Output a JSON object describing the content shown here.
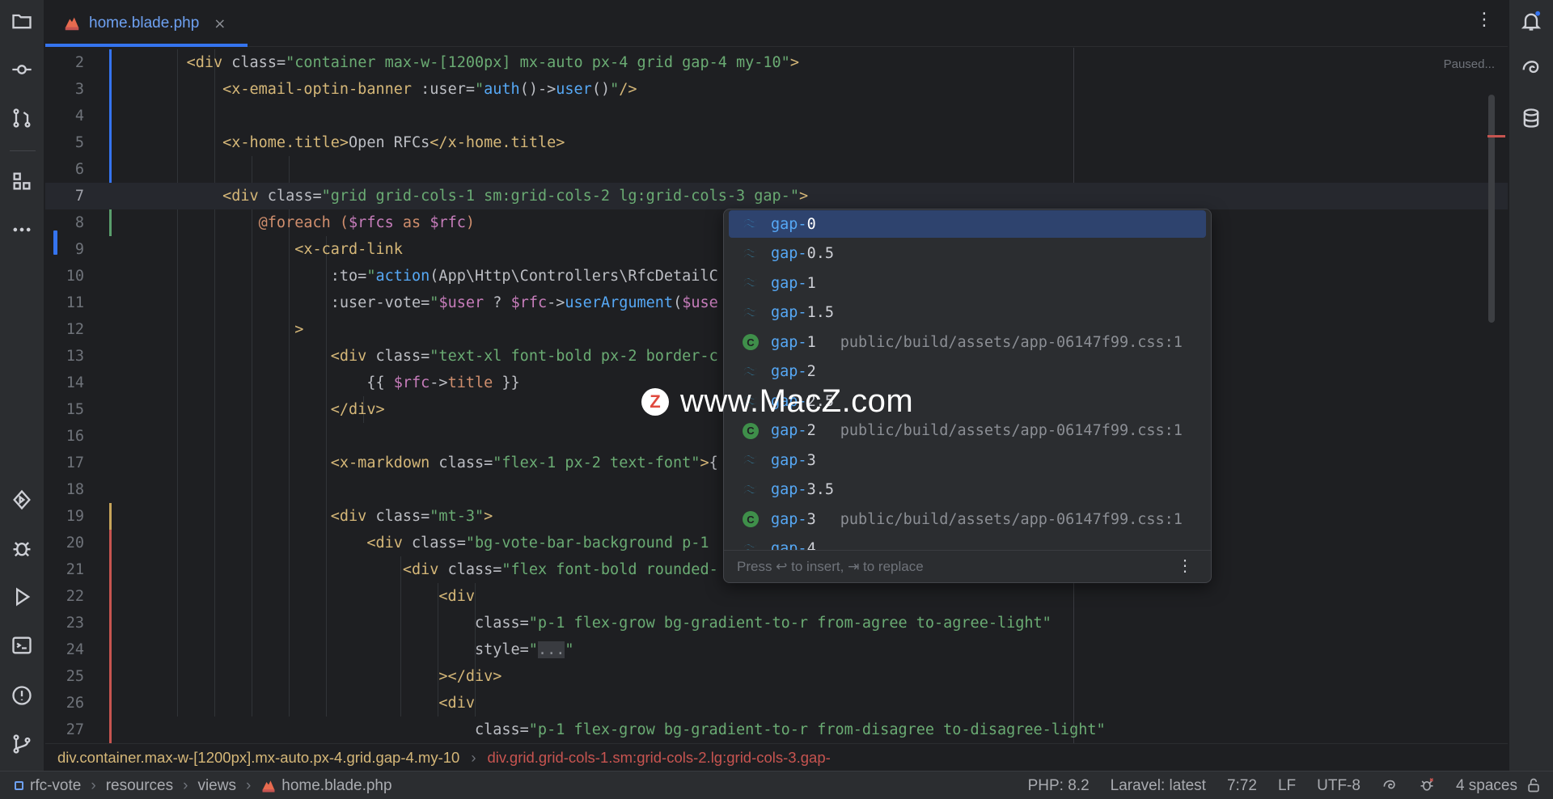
{
  "tab": {
    "label": "home.blade.php",
    "close": "×",
    "more": "⋮"
  },
  "editor": {
    "status": "Paused..."
  },
  "lines": [
    {
      "n": "2",
      "tokens": [
        [
          "t-plain",
          "    "
        ],
        [
          "t-tag",
          "<div"
        ],
        [
          "t-attr",
          " class="
        ],
        [
          "t-str",
          "\"container max-w-[1200px] mx-auto px-4 grid gap-4 my-10\""
        ],
        [
          "t-tag",
          ">"
        ]
      ]
    },
    {
      "n": "3",
      "tokens": [
        [
          "t-plain",
          "        "
        ],
        [
          "t-tag",
          "<x-email-optin-banner"
        ],
        [
          "t-attr",
          " :user="
        ],
        [
          "t-str",
          "\""
        ],
        [
          "t-fn",
          "auth"
        ],
        [
          "t-plain",
          "()->"
        ],
        [
          "t-fn",
          "user"
        ],
        [
          "t-plain",
          "()"
        ],
        [
          "t-str",
          "\""
        ],
        [
          "t-tag",
          "/>"
        ]
      ]
    },
    {
      "n": "4",
      "tokens": []
    },
    {
      "n": "5",
      "tokens": [
        [
          "t-plain",
          "        "
        ],
        [
          "t-tag",
          "<x-home.title>"
        ],
        [
          "t-plain",
          "Open RFCs"
        ],
        [
          "t-tag",
          "</x-home.title>"
        ]
      ]
    },
    {
      "n": "6",
      "tokens": []
    },
    {
      "n": "7",
      "tokens": [
        [
          "t-plain",
          "        "
        ],
        [
          "t-tag",
          "<div"
        ],
        [
          "t-attr",
          " class="
        ],
        [
          "t-str",
          "\"grid grid-cols-1 sm:grid-cols-2 lg:grid-cols-3 gap-\""
        ],
        [
          "t-tag",
          ">"
        ]
      ]
    },
    {
      "n": "8",
      "tokens": [
        [
          "t-plain",
          "            "
        ],
        [
          "t-blade",
          "@foreach ("
        ],
        [
          "t-var",
          "$rfcs"
        ],
        [
          "t-blade",
          " as "
        ],
        [
          "t-var",
          "$rfc"
        ],
        [
          "t-blade",
          ")"
        ]
      ]
    },
    {
      "n": "9",
      "tokens": [
        [
          "t-plain",
          "                "
        ],
        [
          "t-tag",
          "<x-card-link"
        ]
      ]
    },
    {
      "n": "10",
      "tokens": [
        [
          "t-plain",
          "                    "
        ],
        [
          "t-attr",
          ":to="
        ],
        [
          "t-str",
          "\""
        ],
        [
          "t-fn",
          "action"
        ],
        [
          "t-plain",
          "(App\\Http\\Controllers\\RfcDetailC"
        ]
      ]
    },
    {
      "n": "11",
      "tokens": [
        [
          "t-plain",
          "                    "
        ],
        [
          "t-attr",
          ":user-vote="
        ],
        [
          "t-str",
          "\""
        ],
        [
          "t-var",
          "$user"
        ],
        [
          "t-plain",
          " ? "
        ],
        [
          "t-var",
          "$rfc"
        ],
        [
          "t-plain",
          "->"
        ],
        [
          "t-fn",
          "userArgument"
        ],
        [
          "t-plain",
          "("
        ],
        [
          "t-var",
          "$use"
        ]
      ]
    },
    {
      "n": "12",
      "tokens": [
        [
          "t-plain",
          "                "
        ],
        [
          "t-tag",
          ">"
        ]
      ]
    },
    {
      "n": "13",
      "tokens": [
        [
          "t-plain",
          "                    "
        ],
        [
          "t-tag",
          "<div"
        ],
        [
          "t-attr",
          " class="
        ],
        [
          "t-str",
          "\"text-xl font-bold px-2 border-c"
        ]
      ]
    },
    {
      "n": "14",
      "tokens": [
        [
          "t-plain",
          "                        {{ "
        ],
        [
          "t-var",
          "$rfc"
        ],
        [
          "t-plain",
          "->"
        ],
        [
          "t-blade",
          "title"
        ],
        [
          "t-plain",
          " }}"
        ]
      ]
    },
    {
      "n": "15",
      "tokens": [
        [
          "t-plain",
          "                    "
        ],
        [
          "t-tag",
          "</div>"
        ]
      ]
    },
    {
      "n": "16",
      "tokens": []
    },
    {
      "n": "17",
      "tokens": [
        [
          "t-plain",
          "                    "
        ],
        [
          "t-tag",
          "<x-markdown"
        ],
        [
          "t-attr",
          " class="
        ],
        [
          "t-str",
          "\"flex-1 px-2 text-font\""
        ],
        [
          "t-tag",
          ">"
        ],
        [
          "t-plain",
          "{"
        ]
      ]
    },
    {
      "n": "18",
      "tokens": []
    },
    {
      "n": "19",
      "tokens": [
        [
          "t-plain",
          "                    "
        ],
        [
          "t-tag",
          "<div"
        ],
        [
          "t-attr",
          " class="
        ],
        [
          "t-str",
          "\"mt-3\""
        ],
        [
          "t-tag",
          ">"
        ]
      ]
    },
    {
      "n": "20",
      "tokens": [
        [
          "t-plain",
          "                        "
        ],
        [
          "t-tag",
          "<div"
        ],
        [
          "t-attr",
          " class="
        ],
        [
          "t-str",
          "\"bg-vote-bar-background p-1"
        ]
      ]
    },
    {
      "n": "21",
      "tokens": [
        [
          "t-plain",
          "                            "
        ],
        [
          "t-tag",
          "<div"
        ],
        [
          "t-attr",
          " class="
        ],
        [
          "t-str",
          "\"flex font-bold rounded-"
        ]
      ]
    },
    {
      "n": "22",
      "tokens": [
        [
          "t-plain",
          "                                "
        ],
        [
          "t-tag",
          "<div"
        ]
      ]
    },
    {
      "n": "23",
      "tokens": [
        [
          "t-plain",
          "                                    "
        ],
        [
          "t-attr",
          "class="
        ],
        [
          "t-str",
          "\"p-1 flex-grow bg-gradient-to-r from-agree to-agree-light\""
        ]
      ]
    },
    {
      "n": "24",
      "tokens": [
        [
          "t-plain",
          "                                    "
        ],
        [
          "t-attr",
          "style="
        ],
        [
          "t-str",
          "\""
        ],
        [
          "t-dim",
          "..."
        ],
        [
          "t-str",
          "\""
        ]
      ]
    },
    {
      "n": "25",
      "tokens": [
        [
          "t-plain",
          "                                "
        ],
        [
          "t-tag",
          "></div>"
        ]
      ]
    },
    {
      "n": "26",
      "tokens": [
        [
          "t-plain",
          "                                "
        ],
        [
          "t-tag",
          "<div"
        ]
      ]
    },
    {
      "n": "27",
      "tokens": [
        [
          "t-plain",
          "                                    "
        ],
        [
          "t-attr",
          "class="
        ],
        [
          "t-str",
          "\"p-1 flex-grow bg-gradient-to-r from-disagree to-disagree-light\""
        ]
      ]
    }
  ],
  "completion": {
    "items": [
      {
        "prefix": "gap-",
        "rest": "0",
        "icon": "tailwind-icon",
        "location": "",
        "selected": true
      },
      {
        "prefix": "gap-",
        "rest": "0.5",
        "icon": "tailwind-icon",
        "location": ""
      },
      {
        "prefix": "gap-",
        "rest": "1",
        "icon": "tailwind-icon",
        "location": ""
      },
      {
        "prefix": "gap-",
        "rest": "1.5",
        "icon": "tailwind-icon",
        "location": ""
      },
      {
        "prefix": "gap-",
        "rest": "1",
        "icon": "css-class-icon",
        "location": "public/build/assets/app-06147f99.css:1"
      },
      {
        "prefix": "gap-",
        "rest": "2",
        "icon": "tailwind-icon",
        "location": ""
      },
      {
        "prefix": "gap-",
        "rest": "2.5",
        "icon": "tailwind-icon",
        "location": ""
      },
      {
        "prefix": "gap-",
        "rest": "2",
        "icon": "css-class-icon",
        "location": "public/build/assets/app-06147f99.css:1"
      },
      {
        "prefix": "gap-",
        "rest": "3",
        "icon": "tailwind-icon",
        "location": ""
      },
      {
        "prefix": "gap-",
        "rest": "3.5",
        "icon": "tailwind-icon",
        "location": ""
      },
      {
        "prefix": "gap-",
        "rest": "3",
        "icon": "css-class-icon",
        "location": "public/build/assets/app-06147f99.css:1"
      },
      {
        "prefix": "gap-",
        "rest": "4",
        "icon": "tailwind-icon",
        "location": ""
      }
    ],
    "footer": "Press ↩ to insert, ⇥ to replace",
    "footer_more": "⋮"
  },
  "watermark": {
    "logo": "Z",
    "text": "www.MacZ.com"
  },
  "breadcrumb": {
    "first": "div.container.max-w-[1200px].mx-auto.px-4.grid.gap-4.my-10",
    "sep": "›",
    "second": "div.grid.grid-cols-1.sm:grid-cols-2.lg:grid-cols-3.gap-"
  },
  "statusbar": {
    "project": "rfc-vote",
    "path": [
      "resources",
      "views",
      "home.blade.php"
    ],
    "php": "PHP: 8.2",
    "laravel": "Laravel: latest",
    "position": "7:72",
    "line_ending": "LF",
    "encoding": "UTF-8",
    "indent": "4 spaces"
  },
  "colors": {
    "accent": "#3574f0",
    "selection": "#2e436e",
    "error": "#c75450",
    "string": "#6aab73",
    "tag": "#d5b778"
  }
}
